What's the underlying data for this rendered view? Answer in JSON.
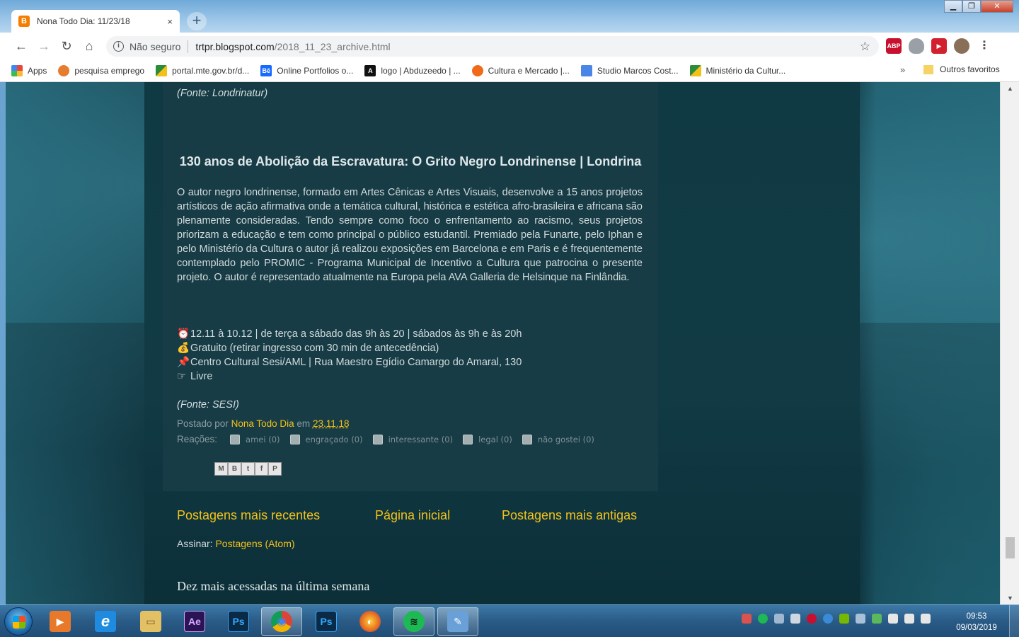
{
  "browser": {
    "tab_title": "Nona Todo Dia: 11/23/18",
    "tab_close": "×",
    "new_tab": "+",
    "security_label": "Não seguro",
    "url_host": "trtpr.blogspot.com",
    "url_path": "/2018_11_23_archive.html",
    "window_buttons": {
      "minimize": "▁",
      "maximize": "❐",
      "close": "✕"
    }
  },
  "bookmarks": {
    "items": [
      {
        "label": "Apps",
        "color": "#e8453c"
      },
      {
        "label": "pesquisa emprego",
        "color": "#e67c2e"
      },
      {
        "label": "portal.mte.gov.br/d...",
        "color": "#2e8b3a"
      },
      {
        "label": "Online Portfolios o...",
        "color": "#1769ff"
      },
      {
        "label": "logo | Abduzeedo | ...",
        "color": "#111111"
      },
      {
        "label": "Cultura e Mercado |...",
        "color": "#f06a1a"
      },
      {
        "label": "Studio Marcos Cost...",
        "color": "#4a86e8"
      },
      {
        "label": "Ministério da Cultur...",
        "color": "#2e8b3a"
      }
    ],
    "more": "»",
    "other": "Outros favoritos"
  },
  "post": {
    "source_top": "(Fonte: Londrinatur)",
    "title": "130 anos de Abolição da Escravatura: O Grito Negro Londrinense | Londrina",
    "body": "O autor negro londrinense, formado em Artes Cênicas e Artes Visuais, desenvolve a 15 anos projetos artísticos de ação afirmativa onde a temática cultural, histórica e estética afro-brasileira e africana são plenamente consideradas. Tendo sempre como foco o enfrentamento ao racismo, seus projetos priorizam a educação e tem como principal o público estudantil. Premiado pela Funarte, pelo Iphan e pelo Ministério da Cultura o autor já realizou exposições em Barcelona e em Paris e é frequentemente contemplado pelo PROMIC - Programa Municipal de Incentivo a Cultura que patrocina o presente projeto. O autor é representado atualmente na Europa pela AVA Galleria de Helsinque na Finlândia.",
    "details": [
      {
        "icon": "⏰",
        "icon_name": "alarm-clock-icon",
        "text": "12.11 à 10.12 | de terça a sábado das 9h às 20 | sábados às 9h e às 20h"
      },
      {
        "icon": "💰",
        "icon_name": "money-bag-icon",
        "text": "Gratuito (retirar ingresso com 30 min de antecedência)"
      },
      {
        "icon": "📌",
        "icon_name": "pushpin-icon",
        "text": "Centro Cultural Sesi/AML | Rua Maestro Egídio Camargo do Amaral, 130"
      },
      {
        "icon": "☞",
        "icon_name": "pointing-hand-icon",
        "text": "Livre"
      }
    ],
    "source_bottom": "(Fonte: SESI)",
    "posted_by_label": "Postado por",
    "author": "Nona Todo Dia",
    "at_label": "em",
    "date": "23.11.18",
    "reactions_label": "Reações:",
    "reactions": [
      {
        "label": "amei (0)"
      },
      {
        "label": "engraçado (0)"
      },
      {
        "label": "interessante (0)"
      },
      {
        "label": "legal (0)"
      },
      {
        "label": "não gostei (0)"
      }
    ],
    "share_buttons": [
      "M",
      "B",
      "t",
      "f",
      "P"
    ]
  },
  "pager": {
    "newer": "Postagens mais recentes",
    "home": "Página inicial",
    "older": "Postagens mais antigas"
  },
  "subscribe": {
    "label": "Assinar:",
    "link": "Postagens (Atom)"
  },
  "sidebar_widget": {
    "title": "Dez mais acessadas na última semana"
  },
  "taskbar": {
    "time": "09:53",
    "date": "09/03/2019",
    "apps": [
      {
        "name": "media-player",
        "label": "▶",
        "color": "#e8792b"
      },
      {
        "name": "internet-explorer",
        "label": "e",
        "color": "#1f8be0"
      },
      {
        "name": "file-explorer",
        "label": "▭",
        "color": "#e4c065"
      },
      {
        "name": "after-effects",
        "label": "Ae",
        "color": "#2a1454"
      },
      {
        "name": "photoshop",
        "label": "Ps",
        "color": "#0b2a45"
      },
      {
        "name": "chrome",
        "label": "◉",
        "color": "#d93a2b"
      },
      {
        "name": "photoshop-2",
        "label": "Ps",
        "color": "#0b2a45"
      },
      {
        "name": "firefox",
        "label": "◐",
        "color": "#e56b1f"
      },
      {
        "name": "spotify",
        "label": "≋",
        "color": "#1db954"
      },
      {
        "name": "paint",
        "label": "✎",
        "color": "#6aa0d8"
      }
    ]
  }
}
